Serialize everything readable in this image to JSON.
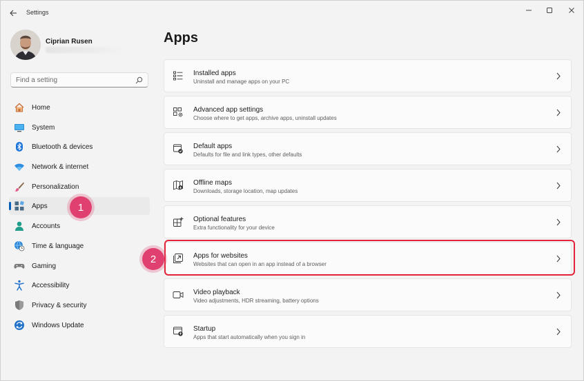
{
  "window": {
    "title": "Settings"
  },
  "profile": {
    "name": "Ciprian Rusen"
  },
  "search": {
    "placeholder": "Find a setting"
  },
  "sidebar": {
    "items": [
      {
        "label": "Home",
        "icon": "home-icon"
      },
      {
        "label": "System",
        "icon": "monitor-icon"
      },
      {
        "label": "Bluetooth & devices",
        "icon": "bluetooth-icon"
      },
      {
        "label": "Network & internet",
        "icon": "wifi-icon"
      },
      {
        "label": "Personalization",
        "icon": "brush-icon"
      },
      {
        "label": "Apps",
        "icon": "apps-icon",
        "active": true
      },
      {
        "label": "Accounts",
        "icon": "person-icon"
      },
      {
        "label": "Time & language",
        "icon": "globe-clock-icon"
      },
      {
        "label": "Gaming",
        "icon": "gamepad-icon"
      },
      {
        "label": "Accessibility",
        "icon": "accessibility-icon"
      },
      {
        "label": "Privacy & security",
        "icon": "shield-icon"
      },
      {
        "label": "Windows Update",
        "icon": "update-icon"
      }
    ]
  },
  "main": {
    "title": "Apps",
    "cards": [
      {
        "title": "Installed apps",
        "subtitle": "Uninstall and manage apps on your PC",
        "icon": "list-icon"
      },
      {
        "title": "Advanced app settings",
        "subtitle": "Choose where to get apps, archive apps, uninstall updates",
        "icon": "app-settings-icon"
      },
      {
        "title": "Default apps",
        "subtitle": "Defaults for file and link types, other defaults",
        "icon": "default-apps-icon"
      },
      {
        "title": "Offline maps",
        "subtitle": "Downloads, storage location, map updates",
        "icon": "map-icon"
      },
      {
        "title": "Optional features",
        "subtitle": "Extra functionality for your device",
        "icon": "optional-features-icon"
      },
      {
        "title": "Apps for websites",
        "subtitle": "Websites that can open in an app instead of a browser",
        "icon": "open-link-icon"
      },
      {
        "title": "Video playback",
        "subtitle": "Video adjustments, HDR streaming, battery options",
        "icon": "video-icon"
      },
      {
        "title": "Startup",
        "subtitle": "Apps that start automatically when you sign in",
        "icon": "startup-icon"
      }
    ]
  },
  "annotations": {
    "step1": "1",
    "step2": "2"
  },
  "colors": {
    "accent": "#005fb8",
    "badge": "#e0406f",
    "highlight": "#e4233b"
  }
}
